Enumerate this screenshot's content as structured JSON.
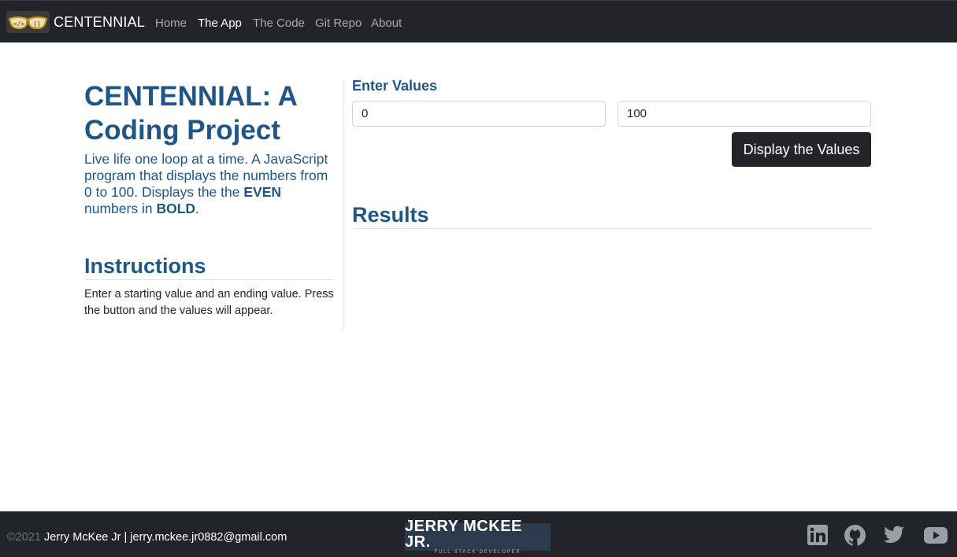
{
  "navbar": {
    "brand": "CENTENNIAL",
    "links": [
      "Home",
      "The App",
      "The Code",
      "Git Repo",
      "About"
    ],
    "active": "The App"
  },
  "intro": {
    "title": "CENTENNIAL: A Coding Project",
    "lead_part1": "Live life one loop at a time. A JavaScript program that displays the numbers from 0 to 100. Displays the the ",
    "lead_em1": "EVEN",
    "lead_part2": " numbers in ",
    "lead_em2": "BOLD",
    "lead_part3": "."
  },
  "instructions": {
    "heading": "Instructions",
    "text": "Enter a starting value and an ending value. Press the button and the values will appear."
  },
  "form": {
    "label": "Enter Values",
    "start_value": "0",
    "end_value": "100",
    "button_label": "Display the Values"
  },
  "results": {
    "heading": "Results"
  },
  "footer": {
    "copyright_year": "©2021",
    "contact": "Jerry McKee Jr | jerry.mckee.jr0882@gmail.com",
    "logo_name": "JERRY MCKEE JR.",
    "logo_tagline": "FULL STACK DEVELOPER",
    "social_icons": [
      "linkedin-icon",
      "github-icon",
      "twitter-icon",
      "youtube-icon"
    ]
  },
  "colors": {
    "navbar_bg": "#212529",
    "heading_blue": "#1f5688",
    "button_bg": "#212529",
    "muted_link": "#a8abad"
  }
}
